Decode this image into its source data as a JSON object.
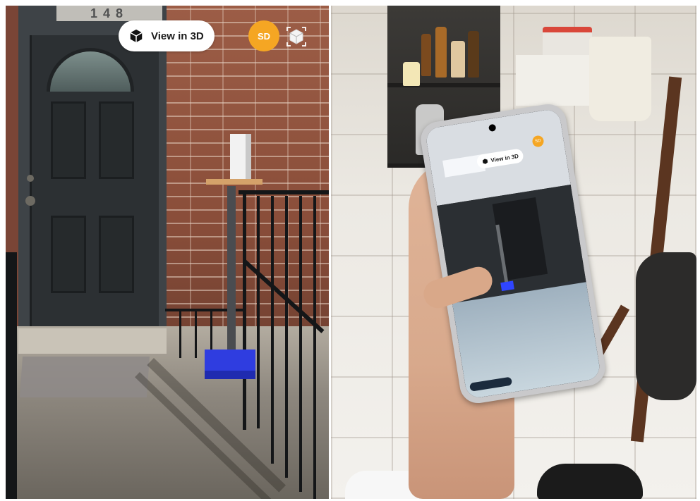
{
  "left_scene": {
    "house_number": "148",
    "ar_button": {
      "label": "View in 3D",
      "icon": "cube-icon"
    },
    "avatar": {
      "initials": "SD",
      "color": "#f5a623"
    },
    "mode_switch_icon": "ar-cube-icon",
    "ar_object_colors": {
      "base": "#2f3de0",
      "pole": "#4a4c50",
      "shelf": "#d4a26a",
      "box": "#f2f2f2"
    }
  },
  "right_scene": {
    "phone_screen": {
      "ar_button": {
        "label": "View in 3D"
      },
      "avatar": {
        "initials": "SD"
      }
    }
  }
}
